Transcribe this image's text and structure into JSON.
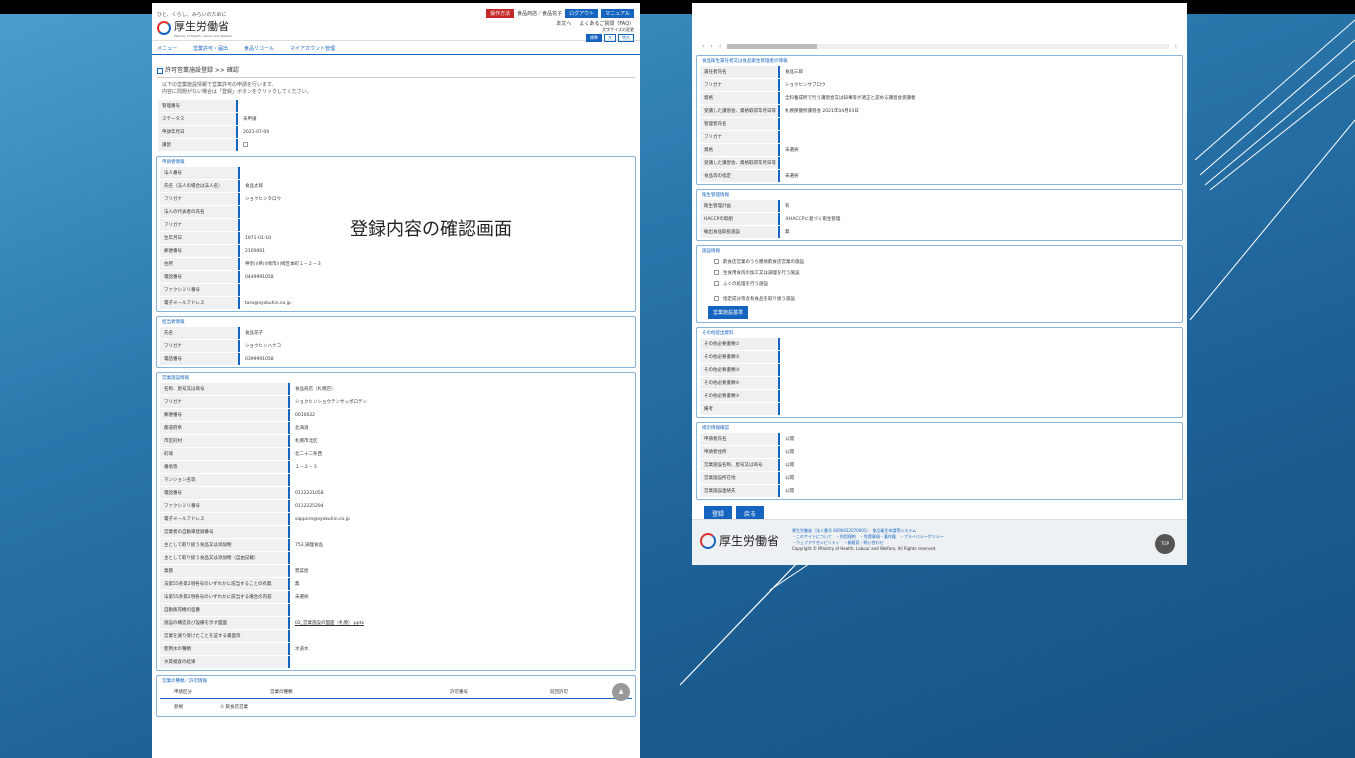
{
  "left": {
    "tagline": "ひと、くらし、みらいのために",
    "logo": "厚生労働省",
    "logo_sub": "Ministry of Health, Labour and Welfare",
    "header_badges": [
      "操作方法",
      "食品商店／食品花子",
      "ログアウト",
      "マニュアル"
    ],
    "header_links": [
      "本文へ",
      "よくあるご質問（FAQ）"
    ],
    "font_size_label": "文字サイズの変更",
    "font_size_buttons": [
      "標準",
      "大",
      "特大"
    ],
    "nav": [
      "メニュー",
      "営業許可・届出",
      "食品リコール",
      "マイアカウント管理"
    ],
    "page_title": "許可営業施設登録 >> 確認",
    "instructions": [
      "以下の営業施設情報で営業許可の申請を行います。",
      "内容に問題がない場合は「登録」ボタンをクリックしてください。"
    ],
    "overlay": "登録内容の確認画面",
    "basic": [
      [
        "管理番号",
        ""
      ],
      [
        "ステータス",
        "未申請"
      ],
      [
        "申請年月日",
        "2021-07-09"
      ],
      [
        "講習",
        ""
      ]
    ],
    "applicant_title": "申請者情報",
    "applicant": [
      [
        "法人番号",
        ""
      ],
      [
        "氏名（法人の場合は法人名）",
        "食品太郎"
      ],
      [
        "フリガナ",
        "ショクヒンタロウ"
      ],
      [
        "法人の代表者の氏名",
        ""
      ],
      [
        "フリガナ",
        ""
      ],
      [
        "生年月日",
        "1971-01-10"
      ],
      [
        "郵便番号",
        "2100001"
      ],
      [
        "住所",
        "神奈川県川崎市川崎区本町１－２－３"
      ],
      [
        "電話番号",
        "0449991058"
      ],
      [
        "ファクシミリ番号",
        ""
      ],
      [
        "電子メールアドレス",
        "taro@syokuhin.co.jp"
      ]
    ],
    "contact_title": "担当者情報",
    "contact": [
      [
        "氏名",
        "食品花子"
      ],
      [
        "フリガナ",
        "ショクヒンハナコ"
      ],
      [
        "電話番号",
        "0399991058"
      ]
    ],
    "facility_title": "営業施設情報",
    "facility": [
      [
        "名称、屋号又は商号",
        "食品商店（札幌店）"
      ],
      [
        "フリガナ",
        "ショクヒンショウテンサッポロテン"
      ],
      [
        "郵便番号",
        "0010022"
      ],
      [
        "都道府県",
        "北海道"
      ],
      [
        "市区町村",
        "札幌市北区"
      ],
      [
        "町域",
        "北二十二条西"
      ],
      [
        "番地等",
        "１－２－３"
      ],
      [
        "マンション名等",
        ""
      ],
      [
        "電話番号",
        "0112221058"
      ],
      [
        "ファクシミリ番号",
        "0112225294"
      ],
      [
        "電子メールアドレス",
        "sapporo@syokuhin.co.jp"
      ],
      [
        "営業者の自動車登録番号",
        ""
      ],
      [
        "主として取り扱う食品又は添加物",
        "753 調理食品"
      ],
      [
        "主として取り扱う食品又は添加物（自由記載）",
        ""
      ],
      [
        "業態",
        "惣菜屋"
      ],
      [
        "法第55条第2項各号のいずれかに該当することの有無",
        "無"
      ],
      [
        "法第55条第2項各号のいずれかに該当する場合の内容",
        "未選択"
      ],
      [
        "自動販売機の型番",
        ""
      ],
      [
        "施設の構造及び設備を示す図面",
        "02_営業施設の図面（札幌）.pptx"
      ],
      [
        "営業を譲り受けたことを証する書面等",
        ""
      ],
      [
        "使用水の種類",
        "水道水"
      ],
      [
        "水質検査の結果",
        ""
      ]
    ],
    "kind_title": "営業の種類／許可情報",
    "kind_headers": [
      "申請区分",
      "営業の種類",
      "許可番号",
      "前回許可"
    ],
    "kind_row": [
      "新規",
      "① 飲食店営業",
      "",
      ""
    ]
  },
  "right": {
    "hygiene_title": "食品衛生責任者又は食品衛生管理者の情報",
    "hygiene": [
      [
        "責任者氏名",
        "食品三郎"
      ],
      [
        "フリガナ",
        "ショクヒンサブロウ"
      ],
      [
        "資格",
        "全科養成所で行う講習会又は知事等が適正と認める講習会受講者"
      ],
      [
        "受講した講習会、資格取得年月日等",
        "札幌保健所講習会 2021年04月03日"
      ],
      [
        "管理者氏名",
        ""
      ],
      [
        "フリガナ",
        ""
      ],
      [
        "資格",
        "未選択"
      ],
      [
        "受講した講習会、資格取得年月日等",
        ""
      ],
      [
        "食品等の指定",
        "未選択"
      ]
    ],
    "plan_title": "衛生管理情報",
    "plan": [
      [
        "衛生管理計画",
        "有"
      ],
      [
        "HACCPの取組",
        "②HACCPに基づく衛生管理"
      ],
      [
        "輸出食品取扱施設",
        "無"
      ]
    ],
    "facility_info_title": "施設情報",
    "facility_checks": [
      "飲食店営業のうち簡易飲食店営業の施設",
      "生食用食肉の加工又は調理を行う施設",
      "ふぐの処理を行う施設",
      "指定成分等含有食品を取り扱う施設"
    ],
    "facility_button": "営業施設基準",
    "other_title": "その他提出資料",
    "other": [
      [
        "その他必要書類①",
        ""
      ],
      [
        "その他必要書類②",
        ""
      ],
      [
        "その他必要書類③",
        ""
      ],
      [
        "その他必要書類④",
        ""
      ],
      [
        "その他必要書類⑤",
        ""
      ],
      [
        "備考",
        ""
      ]
    ],
    "disclosure_title": "揭示情報確認",
    "disclosure": [
      [
        "申請者氏名",
        "公開"
      ],
      [
        "申請者住所",
        "公開"
      ],
      [
        "営業施設名称、屋号又は商号",
        "公開"
      ],
      [
        "営業施設所在地",
        "公開"
      ],
      [
        "営業施設連絡先",
        "公開"
      ]
    ],
    "buttons": [
      "登録",
      "戻る"
    ],
    "footer_logo": "厚生労働省",
    "footer_lines": [
      "厚生労働省（法人番号 6000012070001）　食品衛生申請等システム",
      "・このサイトについて　・利用規約　・免責事項・著作権　・プライバシーポリシー",
      "・ウェブアクセシビリティ　・御意見・問い合わせ"
    ],
    "copyright": "Copyright © Ministry of Health, Labour and Welfare, All Rights reserved.",
    "top_label": "TOP"
  }
}
